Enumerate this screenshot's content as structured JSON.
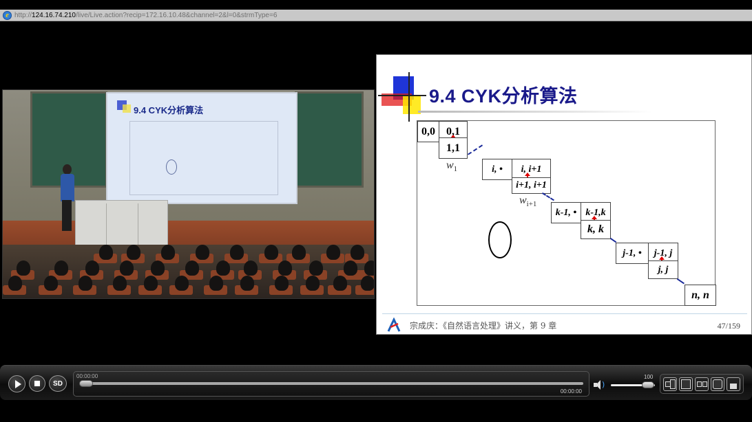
{
  "address_bar": {
    "url_prefix": "http://",
    "url_host": "124.16.74.210",
    "url_rest": "/live/Live.action?recip=172.16.10.48&channel=2&l=0&strmType=6"
  },
  "video": {
    "screen_title": "9.4 CYK分析算法"
  },
  "slide": {
    "title": "9.4 CYK分析算法",
    "cells": {
      "c00": "0,0",
      "c01": "0,1",
      "c11": "1,1",
      "ci_dot": "i, •",
      "ci_i1": "i, i+1",
      "ci1_i1": "i+1, i+1",
      "ck1_dot": "k-1, •",
      "ck1_k": "k-1,k",
      "ckk": "k, k",
      "cj1_dot": "j-1, •",
      "cj1_j": "j-1, j",
      "cjj": "j, j",
      "cnn": "n, n"
    },
    "labels": {
      "w1_base": "w",
      "w1_sub": "1",
      "wi_base": "w",
      "wi_sub": "i+1"
    },
    "footer_text": "宗成庆：《自然语言处理》讲义，第 9 章",
    "page": "47/159"
  },
  "player": {
    "sd_label": "SD",
    "current_time": "00:00:00",
    "duration": "00:00:00",
    "volume_value": "100",
    "progress": 0,
    "volume": 1.0
  },
  "colors": {
    "slide_title": "#1a1a8a",
    "arrow": "#dd0000",
    "dash": "#1a2a9a",
    "stage": "#9a4c2c"
  }
}
